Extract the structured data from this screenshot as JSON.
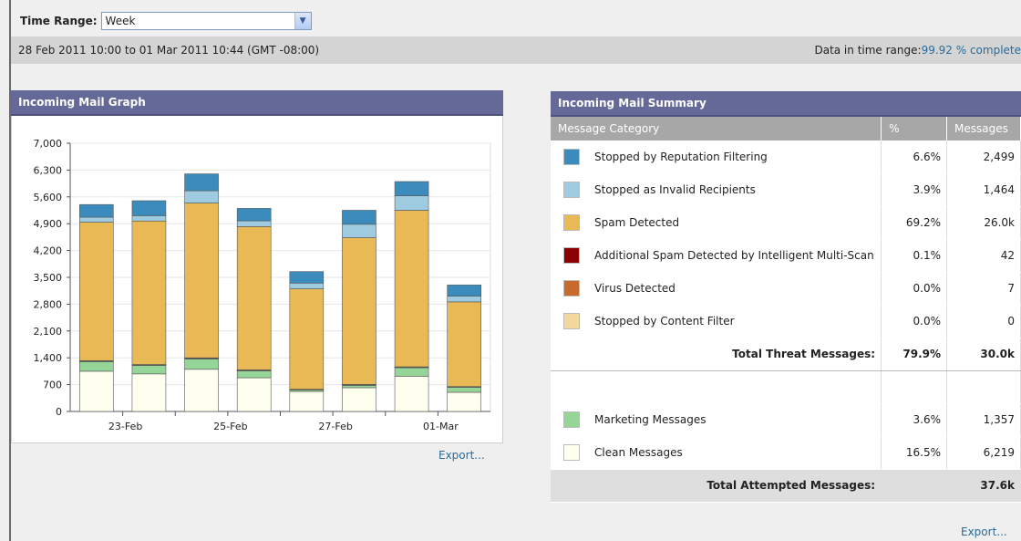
{
  "time_range": {
    "label": "Time Range:",
    "value": "Week"
  },
  "range_bar": {
    "period": "28 Feb 2011 10:00 to 01 Mar 2011 10:44 (GMT -08:00)",
    "data_label": "Data in time range:",
    "data_value": "99.92 % complete"
  },
  "graph": {
    "title": "Incoming Mail Graph",
    "export": "Export..."
  },
  "colors": {
    "clean": "#fffff0",
    "marketing": "#95d597",
    "content_filter": "#f0d99b",
    "virus": "#c86a2c",
    "additional_spam": "#8b0000",
    "spam": "#e9b956",
    "invalid": "#9fcbe0",
    "reputation": "#3b8cbc"
  },
  "chart_data": {
    "type": "bar",
    "stacked": true,
    "ylim": [
      0,
      7000
    ],
    "yticks": [
      "7,000",
      "6,300",
      "5,600",
      "4,900",
      "4,200",
      "3,500",
      "2,800",
      "2,100",
      "1,400",
      "700",
      "0"
    ],
    "ytick_values": [
      7000,
      6300,
      5600,
      4900,
      4200,
      3500,
      2800,
      2100,
      1400,
      700,
      0
    ],
    "xtick_labels": [
      "23-Feb",
      "25-Feb",
      "27-Feb",
      "01-Mar"
    ],
    "xtick_after_bar": [
      1,
      3,
      5,
      7
    ],
    "series": [
      {
        "key": "clean",
        "values": [
          1050,
          980,
          1100,
          880,
          520,
          620,
          920,
          500
        ]
      },
      {
        "key": "marketing",
        "values": [
          250,
          220,
          270,
          180,
          40,
          60,
          220,
          130
        ]
      },
      {
        "key": "content_filter",
        "values": [
          10,
          10,
          10,
          10,
          10,
          10,
          10,
          10
        ]
      },
      {
        "key": "virus",
        "values": [
          5,
          5,
          5,
          5,
          5,
          5,
          5,
          5
        ]
      },
      {
        "key": "additional_spam",
        "values": [
          10,
          10,
          15,
          10,
          5,
          10,
          10,
          5
        ]
      },
      {
        "key": "spam",
        "values": [
          3615,
          3745,
          4040,
          3740,
          2620,
          3830,
          4085,
          2210
        ]
      },
      {
        "key": "invalid",
        "values": [
          130,
          140,
          320,
          150,
          150,
          350,
          380,
          150
        ]
      },
      {
        "key": "reputation",
        "values": [
          330,
          390,
          440,
          325,
          300,
          365,
          370,
          290
        ]
      }
    ]
  },
  "summary": {
    "title": "Incoming Mail Summary",
    "headers": [
      "Message Category",
      "%",
      "Messages"
    ],
    "rows": [
      {
        "label": "Stopped by Reputation Filtering",
        "pct": "6.6%",
        "count": "2,499",
        "color": "#3b8cbc"
      },
      {
        "label": "Stopped as Invalid Recipients",
        "pct": "3.9%",
        "count": "1,464",
        "color": "#9fcbe0"
      },
      {
        "label": "Spam Detected",
        "pct": "69.2%",
        "count": "26.0k",
        "color": "#e9b956"
      },
      {
        "label": "Additional Spam Detected by Intelligent Multi-Scan",
        "pct": "0.1%",
        "count": "42",
        "color": "#8b0000"
      },
      {
        "label": "Virus Detected",
        "pct": "0.0%",
        "count": "7",
        "color": "#c86a2c"
      },
      {
        "label": "Stopped by Content Filter",
        "pct": "0.0%",
        "count": "0",
        "color": "#f0d99b"
      }
    ],
    "total_threat": {
      "label": "Total Threat Messages:",
      "pct": "79.9%",
      "count": "30.0k"
    },
    "rows2": [
      {
        "label": "Marketing Messages",
        "pct": "3.6%",
        "count": "1,357",
        "color": "#95d597"
      },
      {
        "label": "Clean Messages",
        "pct": "16.5%",
        "count": "6,219",
        "color": "#fffff0"
      }
    ],
    "total_attempted": {
      "label": "Total Attempted Messages:",
      "pct": "",
      "count": "37.6k"
    },
    "export": "Export..."
  }
}
